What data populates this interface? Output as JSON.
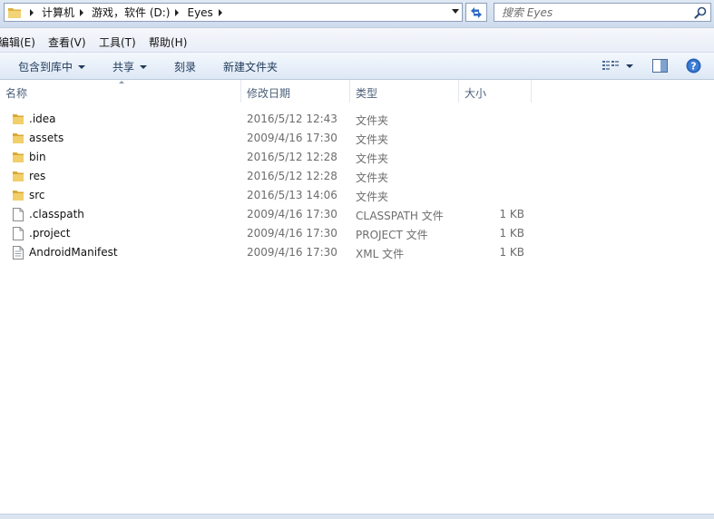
{
  "address": {
    "crumbs": [
      "计算机",
      "游戏，软件 (D:)",
      "Eyes"
    ]
  },
  "search": {
    "placeholder": "搜索 Eyes"
  },
  "menu": [
    "编辑(E)",
    "查看(V)",
    "工具(T)",
    "帮助(H)"
  ],
  "toolbar": {
    "include_library": "包含到库中",
    "share": "共享",
    "burn": "刻录",
    "new_folder": "新建文件夹"
  },
  "columns": {
    "name": "名称",
    "date": "修改日期",
    "type": "类型",
    "size": "大小"
  },
  "files": [
    {
      "name": ".idea",
      "date": "2016/5/12 12:43",
      "type": "文件夹",
      "size": "",
      "icon": "folder-icon"
    },
    {
      "name": "assets",
      "date": "2009/4/16 17:30",
      "type": "文件夹",
      "size": "",
      "icon": "folder-icon"
    },
    {
      "name": "bin",
      "date": "2016/5/12 12:28",
      "type": "文件夹",
      "size": "",
      "icon": "folder-icon"
    },
    {
      "name": "res",
      "date": "2016/5/12 12:28",
      "type": "文件夹",
      "size": "",
      "icon": "folder-icon"
    },
    {
      "name": "src",
      "date": "2016/5/13 14:06",
      "type": "文件夹",
      "size": "",
      "icon": "folder-icon"
    },
    {
      "name": ".classpath",
      "date": "2009/4/16 17:30",
      "type": "CLASSPATH 文件",
      "size": "1 KB",
      "icon": "file-icon"
    },
    {
      "name": ".project",
      "date": "2009/4/16 17:30",
      "type": "PROJECT 文件",
      "size": "1 KB",
      "icon": "file-icon"
    },
    {
      "name": "AndroidManifest",
      "date": "2009/4/16 17:30",
      "type": "XML 文件",
      "size": "1 KB",
      "icon": "xml-file-icon"
    }
  ],
  "colors": {
    "accent": "#1e395b",
    "folder": "#e8c04a",
    "help": "#2a64b8"
  }
}
